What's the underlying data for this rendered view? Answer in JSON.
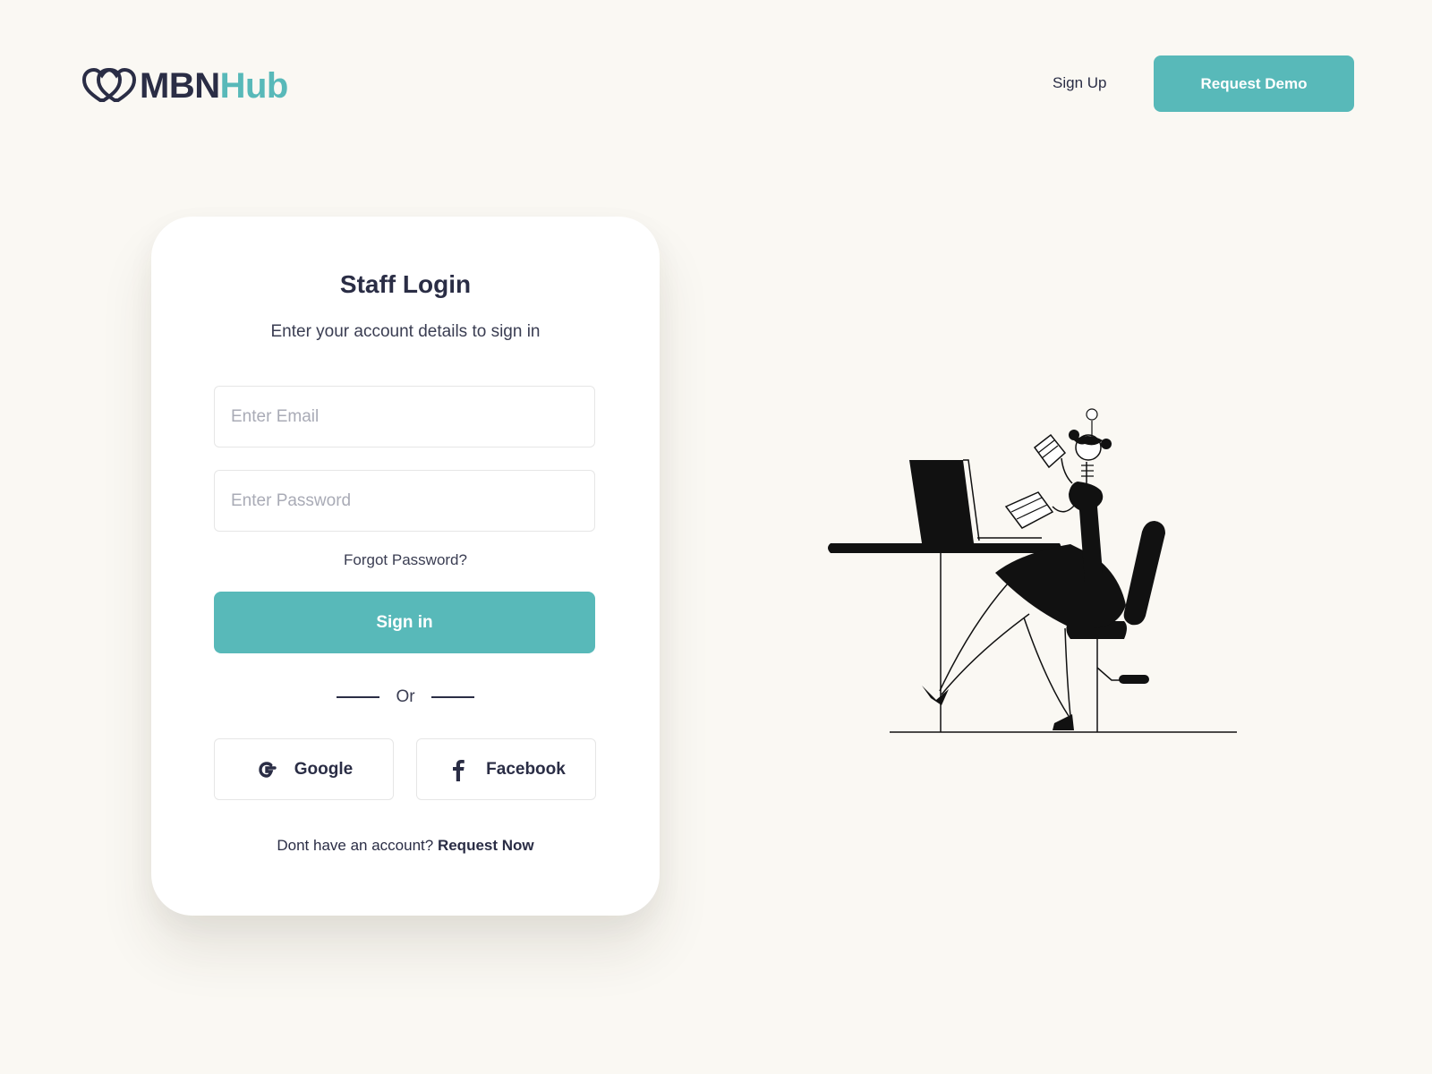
{
  "header": {
    "logo_part1": "MBN",
    "logo_part2": "Hub",
    "signup_label": "Sign Up",
    "demo_label": "Request Demo"
  },
  "login": {
    "title": "Staff Login",
    "subtitle": "Enter your account details to sign in",
    "email_placeholder": "Enter Email",
    "password_placeholder": "Enter Password",
    "forgot_label": "Forgot Password?",
    "signin_label": "Sign in",
    "or_label": "Or",
    "google_label": "Google",
    "facebook_label": "Facebook",
    "no_account_text": "Dont have an account?",
    "request_now_label": "Request Now"
  },
  "icons": {
    "logo": "interlocking-hearts-logo-icon",
    "google": "google-icon",
    "facebook": "facebook-icon",
    "illustration": "woman-at-desk-illustration"
  },
  "colors": {
    "background": "#faf8f3",
    "accent": "#58b9b9",
    "text_dark": "#2a2d45",
    "card": "#ffffff"
  }
}
